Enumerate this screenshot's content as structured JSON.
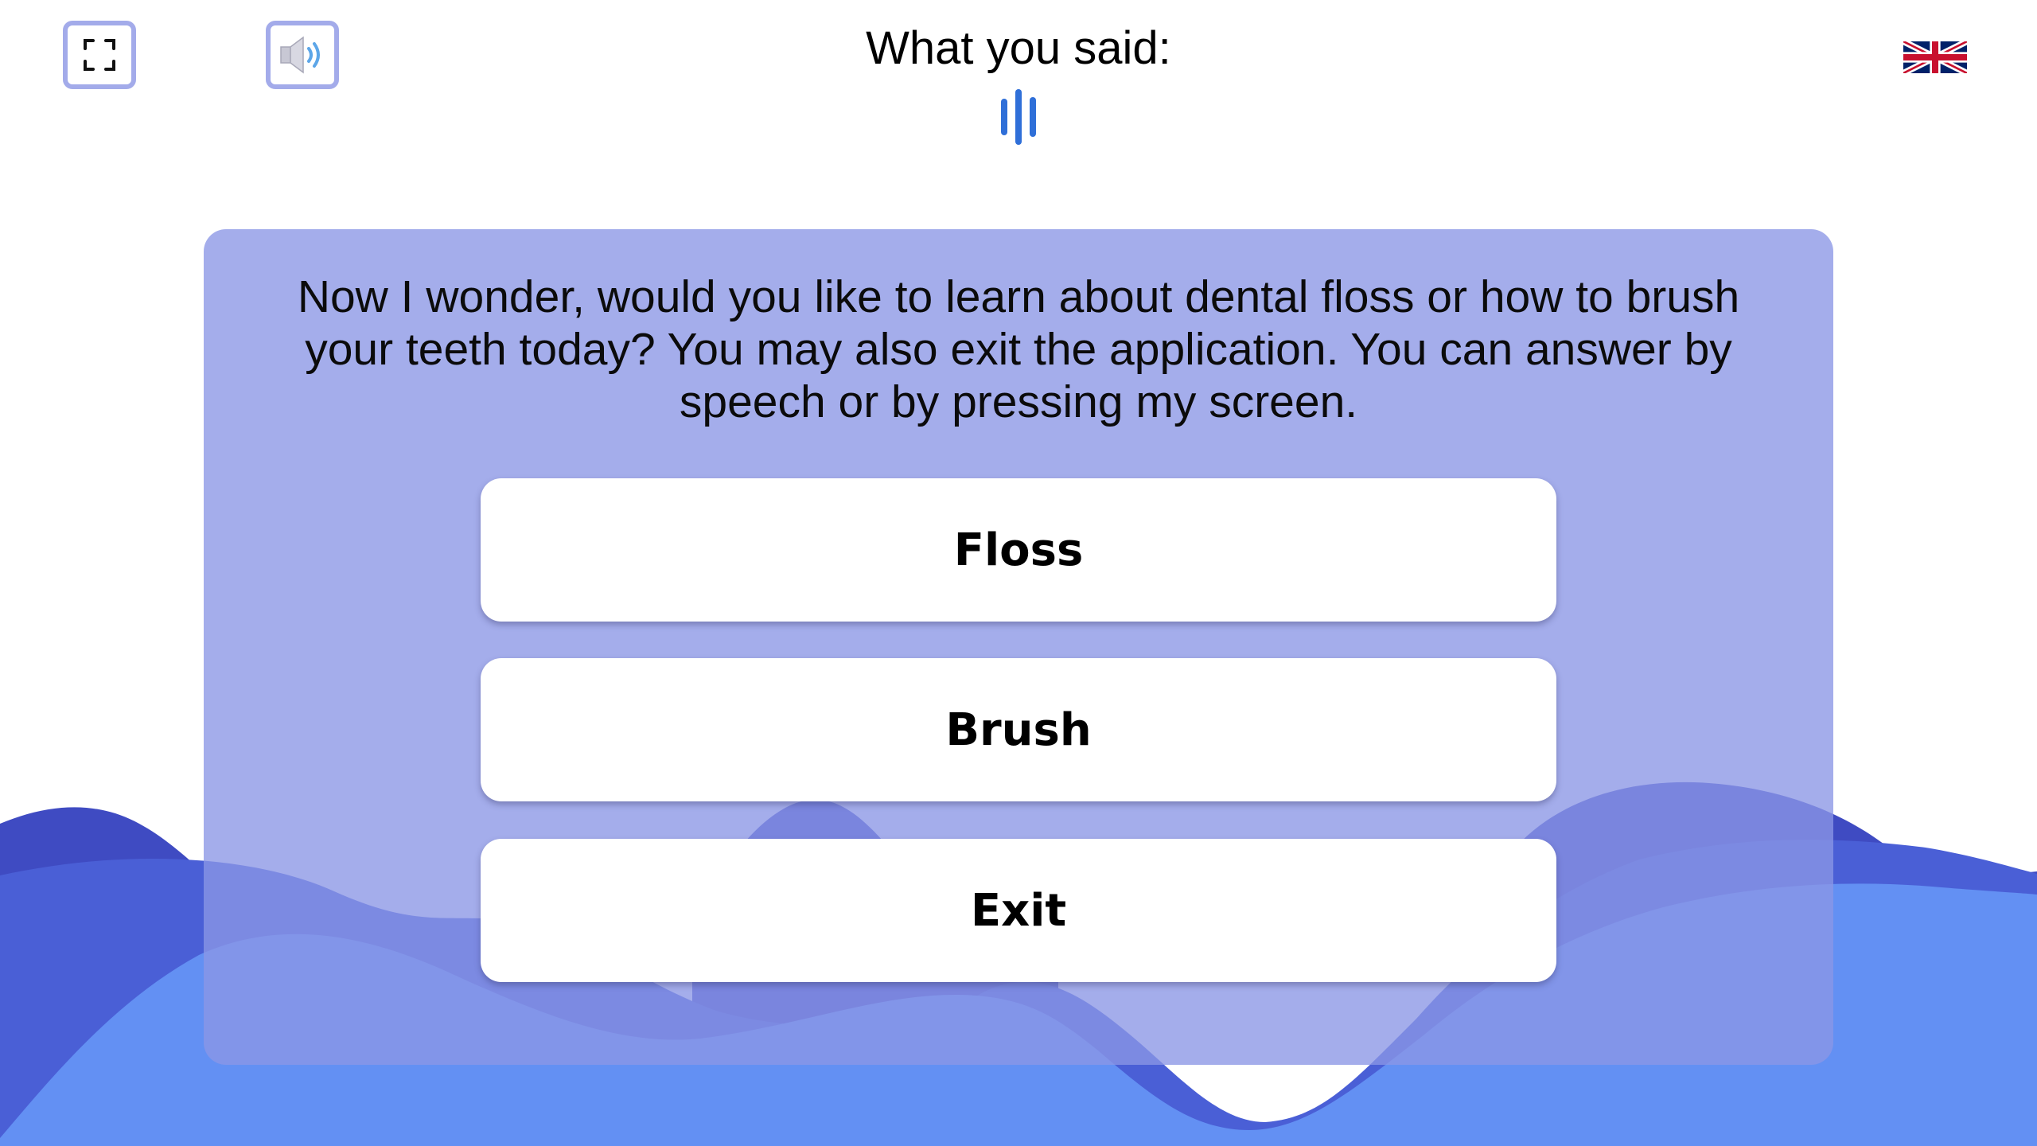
{
  "toolbar": {
    "fullscreen_icon": "fullscreen-icon",
    "sound_icon": "speaker-icon"
  },
  "speech": {
    "label": "What you said:",
    "indicator_icon": "listening-bars-icon"
  },
  "language": {
    "icon": "uk-flag-icon"
  },
  "dialog": {
    "prompt": "Now I wonder, would you like to learn about dental floss or how to brush your teeth today? You may also exit the application. You can answer by speech or by pressing my screen.",
    "options": [
      {
        "label": "Floss"
      },
      {
        "label": "Brush"
      },
      {
        "label": "Exit"
      }
    ]
  },
  "colors": {
    "accent": "#a3abea",
    "panel": "#8a96e5",
    "wave_dark": "#3f4bc2",
    "wave_mid": "#4a5fd6",
    "wave_light": "#6390f3",
    "mic_bars": "#2f6fd8"
  }
}
